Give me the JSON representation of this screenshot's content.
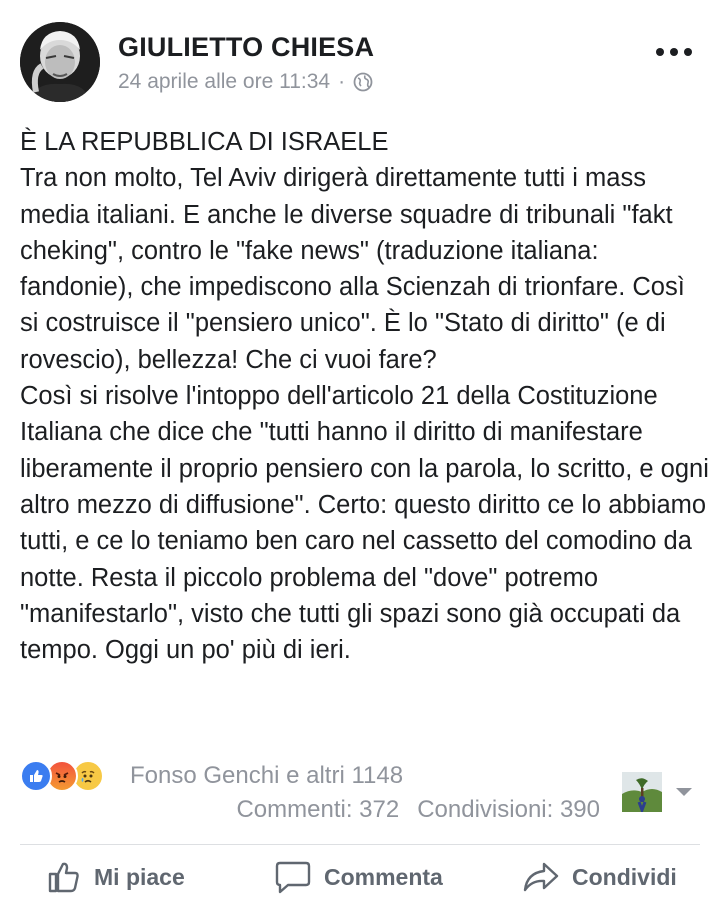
{
  "post": {
    "author": "GIULIETTO CHIESA",
    "timestamp": "24 aprile alle ore 11:34",
    "separator": "·",
    "privacy_icon": "globe-icon",
    "menu_icon": "more-options-icon",
    "text": "È LA REPUBBLICA DI ISRAELE\nTra non molto, Tel Aviv dirigerà direttamente tutti i mass media italiani. E anche le diverse squadre di tribunali \"fakt cheking\", contro le \"fake news\" (traduzione italiana: fandonie), che impediscono alla Scienzah di trionfare. Così si costruisce il \"pensiero unico\". È lo \"Stato di diritto\" (e di rovescio), bellezza! Che ci vuoi fare?\nCosì si risolve l'intoppo dell'articolo 21 della Costituzione Italiana che dice che \"tutti hanno il diritto di manifestare liberamente il proprio pensiero con la parola, lo scritto, e ogni altro mezzo di diffusione\". Certo: questo diritto ce lo abbiamo tutti, e ce lo teniamo ben caro nel cassetto del comodino da notte. Resta il piccolo problema del \"dove\" potremo \"manifestarlo\", visto che tutti gli spazi sono già occupati da tempo. Oggi un po' più di ieri."
  },
  "reactions": {
    "types": [
      "like",
      "angry",
      "sad"
    ],
    "summary": "Fonso Genchi e altri 1148",
    "comments": "Commenti: 372",
    "shares": "Condivisioni: 390"
  },
  "actions": {
    "like": "Mi piace",
    "comment": "Commenta",
    "share": "Condividi"
  },
  "colors": {
    "like_blue": "#3b7df0",
    "text": "#1c1e21",
    "secondary": "#90949c",
    "action_gray": "#606770"
  }
}
